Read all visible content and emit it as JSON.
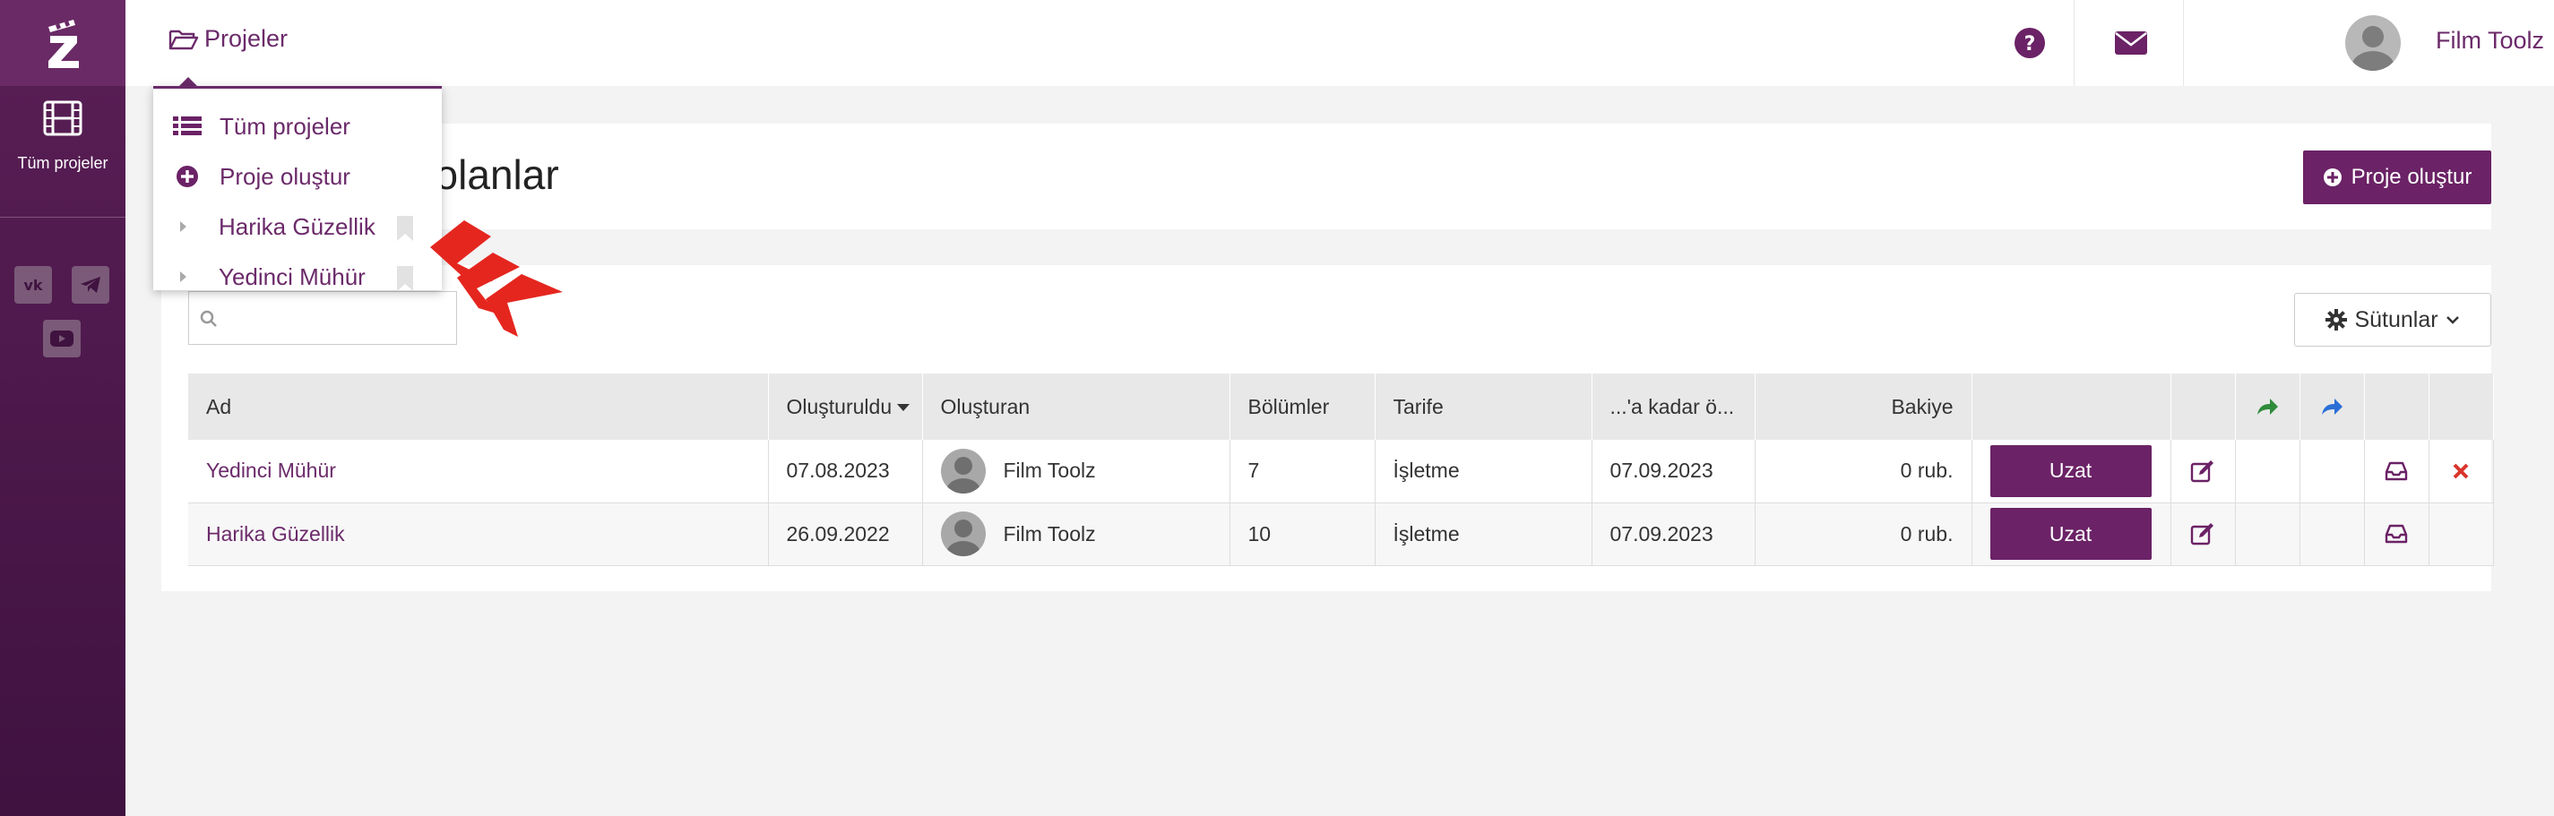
{
  "sidebar": {
    "logo": "Z",
    "items": [
      {
        "label": "Tüm projeler",
        "icon": "film-icon"
      }
    ],
    "social": [
      "vk-icon",
      "telegram-icon",
      "youtube-icon"
    ]
  },
  "topbar": {
    "projects_label": "Projeler",
    "user_name": "Film Toolz",
    "lang": "TR"
  },
  "header": {
    "title": "f olanlar",
    "create_button": "Proje oluştur"
  },
  "toolbar": {
    "search_placeholder": "",
    "columns_button": "Sütunlar"
  },
  "table": {
    "headers": {
      "name": "Ad",
      "created": "Oluşturuldu",
      "creator": "Oluşturan",
      "episodes": "Bölümler",
      "tariff": "Tarife",
      "paid_until": "...'a kadar ö...",
      "balance": "Bakiye"
    },
    "rows": [
      {
        "name": "Yedinci Mühür",
        "created": "07.08.2023",
        "creator": "Film Toolz",
        "episodes": "7",
        "tariff": "İşletme",
        "paid_until": "07.09.2023",
        "balance": "0 rub.",
        "action": "Uzat"
      },
      {
        "name": "Harika Güzellik",
        "created": "26.09.2022",
        "creator": "Film Toolz",
        "episodes": "10",
        "tariff": "İşletme",
        "paid_until": "07.09.2023",
        "balance": "0 rub.",
        "action": "Uzat"
      }
    ]
  },
  "dropdown": {
    "items": [
      {
        "label": "Tüm projeler",
        "icon": "list-icon"
      },
      {
        "label": "Proje oluştur",
        "icon": "plus-circle-icon"
      },
      {
        "label": "Harika Güzellik",
        "icon": "chevron-right-icon"
      },
      {
        "label": "Yedinci Mühür",
        "icon": "chevron-right-icon"
      }
    ]
  },
  "colors": {
    "brand": "#6b2266",
    "sidebar": "#4a1747",
    "arrow_red": "#e5261f",
    "share_green": "#2e8b3a",
    "share_blue": "#2a6fd6",
    "delete_red": "#d9342b"
  }
}
